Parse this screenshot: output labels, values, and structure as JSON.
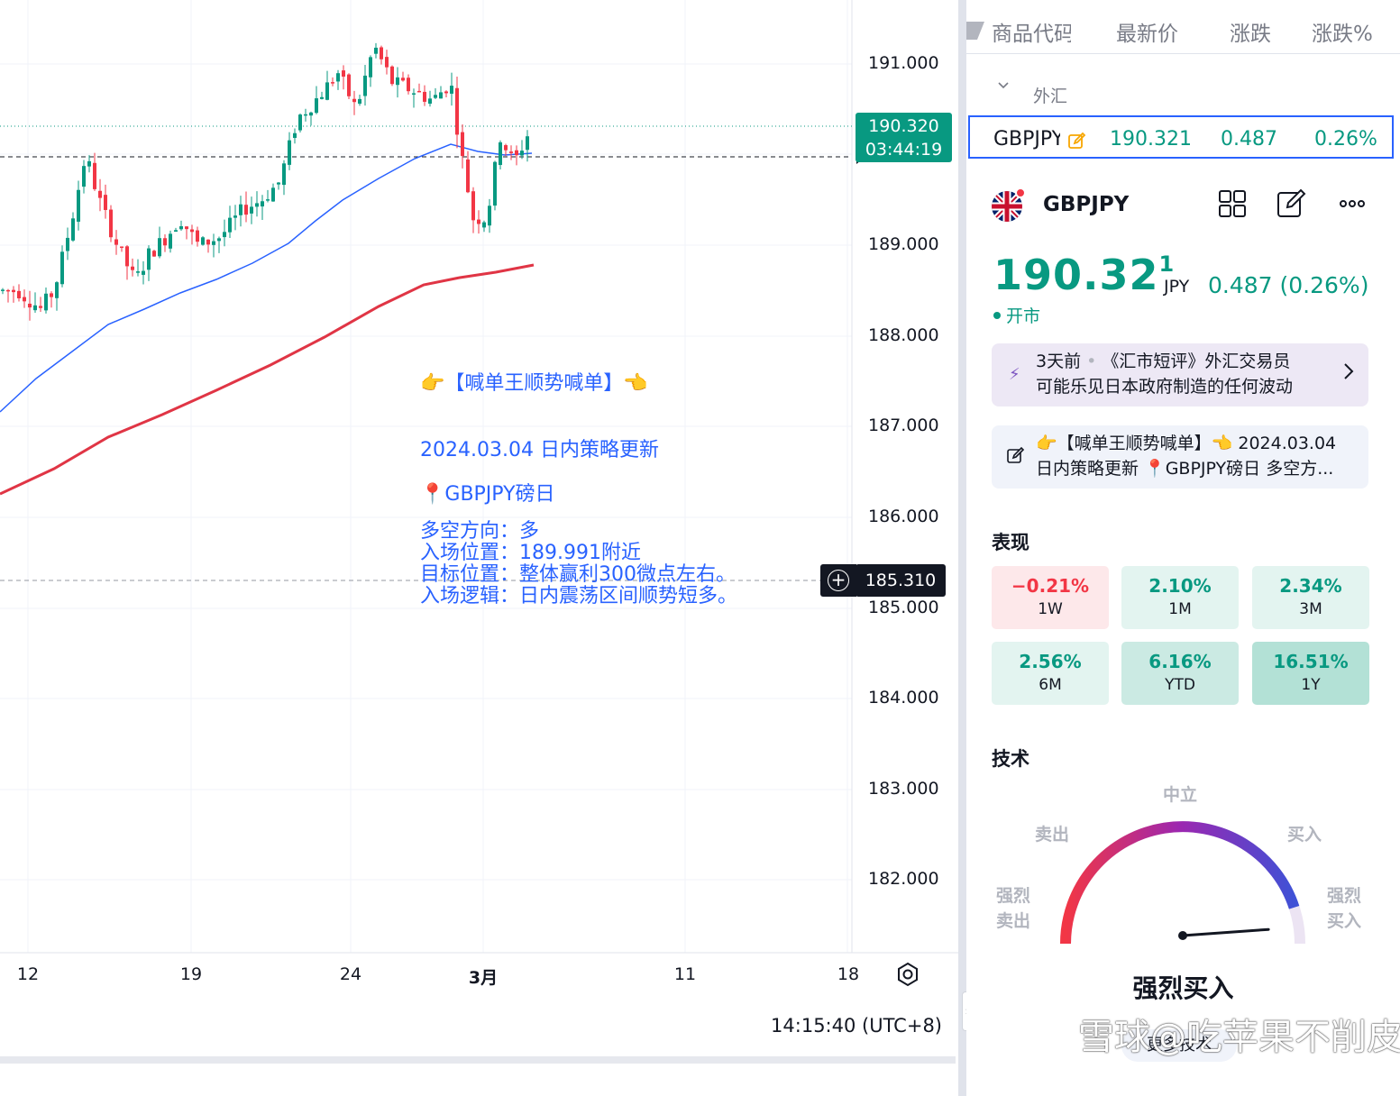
{
  "chart": {
    "price_axis": [
      "191.000",
      "189.000",
      "188.000",
      "187.000",
      "186.000",
      "185.000",
      "184.000",
      "183.000",
      "182.000"
    ],
    "time_axis": [
      "12",
      "19",
      "24",
      "3月",
      "11",
      "18"
    ],
    "current_price": "190.320",
    "countdown": "03:44:19",
    "crosshair_price": "185.310",
    "clock": "14:15:40 (UTC+8)",
    "colors": {
      "up": "#089981",
      "down": "#f23645",
      "ma_fast": "#2962ff",
      "ma_slow": "#e03545",
      "annotation": "#2962ff"
    }
  },
  "annotation": {
    "title": "👉【喊单王顺势喊单】👈",
    "date_line": "2024.03.04 日内策略更新",
    "symbol_line": "📍GBPJPY磅日",
    "lines": [
      "多空方向：多",
      "入场位置：189.991附近",
      "目标位置：整体赢利300微点左右。",
      "入场逻辑：日内震荡区间顺势短多。"
    ]
  },
  "watchlist": {
    "headers": [
      "商品代码",
      "最新价",
      "涨跌",
      "涨跌%"
    ],
    "group_label": "外汇",
    "row": {
      "symbol": "GBPJPY",
      "price": "190.321",
      "change": "0.487",
      "change_pct": "0.26%"
    }
  },
  "details": {
    "symbol": "GBPJPY",
    "price_main": "190.32",
    "price_sup": "1",
    "currency": "JPY",
    "change": "0.487 (0.26%)",
    "status": "开市",
    "news": [
      {
        "prefix": "3天前",
        "text": "《汇市短评》外汇交易员",
        "line2": "可能乐见日本政府制造的任何波动"
      },
      {
        "text": "👉【喊单王顺势喊单】👈 2024.03.04",
        "line2": "日内策略更新 📍GBPJPY磅日 多空方..."
      }
    ],
    "performance_title": "表现",
    "performance": [
      {
        "value": "−0.21%",
        "period": "1W",
        "tone": "neg"
      },
      {
        "value": "2.10%",
        "period": "1M",
        "tone": "pos"
      },
      {
        "value": "2.34%",
        "period": "3M",
        "tone": "pos"
      },
      {
        "value": "2.56%",
        "period": "6M",
        "tone": "pos"
      },
      {
        "value": "6.16%",
        "period": "YTD",
        "tone": "pos2"
      },
      {
        "value": "16.51%",
        "period": "1Y",
        "tone": "pos3"
      }
    ],
    "technicals_title": "技术",
    "gauge": {
      "neutral": "中立",
      "sell": "卖出",
      "buy": "买入",
      "strong_sell_1": "强烈",
      "strong_sell_2": "卖出",
      "strong_buy_1": "强烈",
      "strong_buy_2": "买入",
      "verdict": "强烈买入",
      "level": 0.9
    },
    "more_button": "更多技术"
  },
  "watermark": "雪球@吃苹果不削皮"
}
